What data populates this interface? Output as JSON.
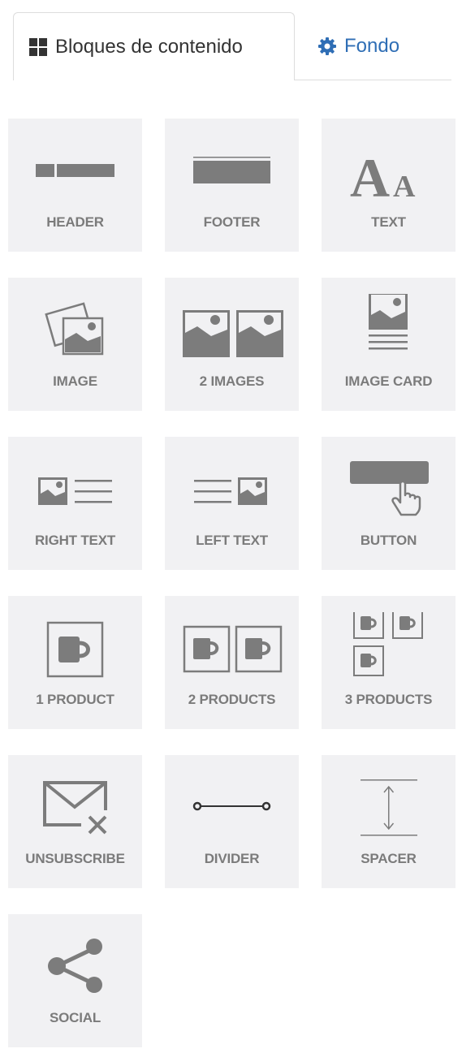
{
  "colors": {
    "tile_bg": "#f1f1f3",
    "icon": "#7c7c7c",
    "label": "#7b7b7b",
    "tab_link": "#2f6eb5",
    "tab_border": "#dddddd"
  },
  "tabs": [
    {
      "label": "Bloques de contenido",
      "icon": "grid-icon",
      "active": true
    },
    {
      "label": "Fondo",
      "icon": "gear-icon",
      "active": false
    }
  ],
  "blocks": [
    {
      "label": "HEADER",
      "icon": "header-icon"
    },
    {
      "label": "FOOTER",
      "icon": "footer-icon"
    },
    {
      "label": "TEXT",
      "icon": "text-icon"
    },
    {
      "label": "IMAGE",
      "icon": "image-icon"
    },
    {
      "label": "2 IMAGES",
      "icon": "two-images-icon"
    },
    {
      "label": "IMAGE CARD",
      "icon": "image-card-icon"
    },
    {
      "label": "RIGHT TEXT",
      "icon": "right-text-icon"
    },
    {
      "label": "LEFT TEXT",
      "icon": "left-text-icon"
    },
    {
      "label": "BUTTON",
      "icon": "button-icon"
    },
    {
      "label": "1 PRODUCT",
      "icon": "one-product-icon"
    },
    {
      "label": "2 PRODUCTS",
      "icon": "two-products-icon"
    },
    {
      "label": "3 PRODUCTS",
      "icon": "three-products-icon"
    },
    {
      "label": "UNSUBSCRIBE",
      "icon": "unsubscribe-icon"
    },
    {
      "label": "DIVIDER",
      "icon": "divider-icon"
    },
    {
      "label": "SPACER",
      "icon": "spacer-icon"
    },
    {
      "label": "SOCIAL",
      "icon": "share-icon"
    }
  ]
}
